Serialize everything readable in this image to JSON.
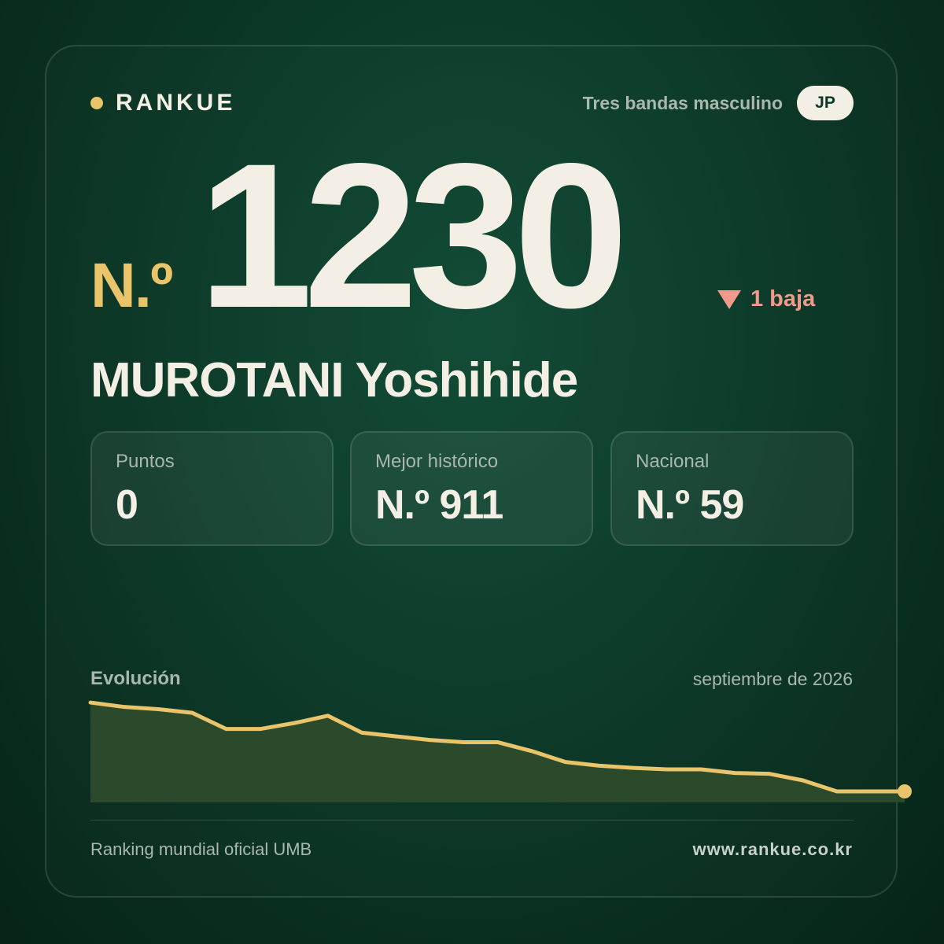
{
  "brand": {
    "name": "RANKUE",
    "dot_color": "#e9c46a"
  },
  "header": {
    "category": "Tres bandas masculino",
    "country_code": "JP"
  },
  "rank": {
    "prefix": "N.º",
    "number": "1230",
    "change_label": "1 baja",
    "change_direction": "down",
    "change_color": "#ef9a8a"
  },
  "player": {
    "name": "MUROTANI Yoshihide"
  },
  "stats": [
    {
      "label": "Puntos",
      "value": "0"
    },
    {
      "label": "Mejor histórico",
      "value": "N.º 911"
    },
    {
      "label": "Nacional",
      "value": "N.º 59"
    }
  ],
  "evolution": {
    "title": "Evolución",
    "date": "septiembre de 2026"
  },
  "chart_data": {
    "type": "area",
    "y_inverted": true,
    "line_color": "#e9c46a",
    "fill_color": "#2b4a2c",
    "grid": false,
    "values": [
      1024,
      1030,
      1033,
      1038,
      1060,
      1060,
      1052,
      1042,
      1065,
      1070,
      1075,
      1078,
      1078,
      1090,
      1105,
      1110,
      1113,
      1115,
      1115,
      1120,
      1121,
      1130,
      1145,
      1145,
      1145
    ],
    "ylim": [
      1010,
      1160
    ]
  },
  "footer": {
    "left": "Ranking mundial oficial UMB",
    "right": "www.rankue.co.kr"
  },
  "colors": {
    "accent": "#e9c46a",
    "text": "#f4efe4",
    "muted": "#a9b8ad",
    "background": "#0a3424"
  }
}
